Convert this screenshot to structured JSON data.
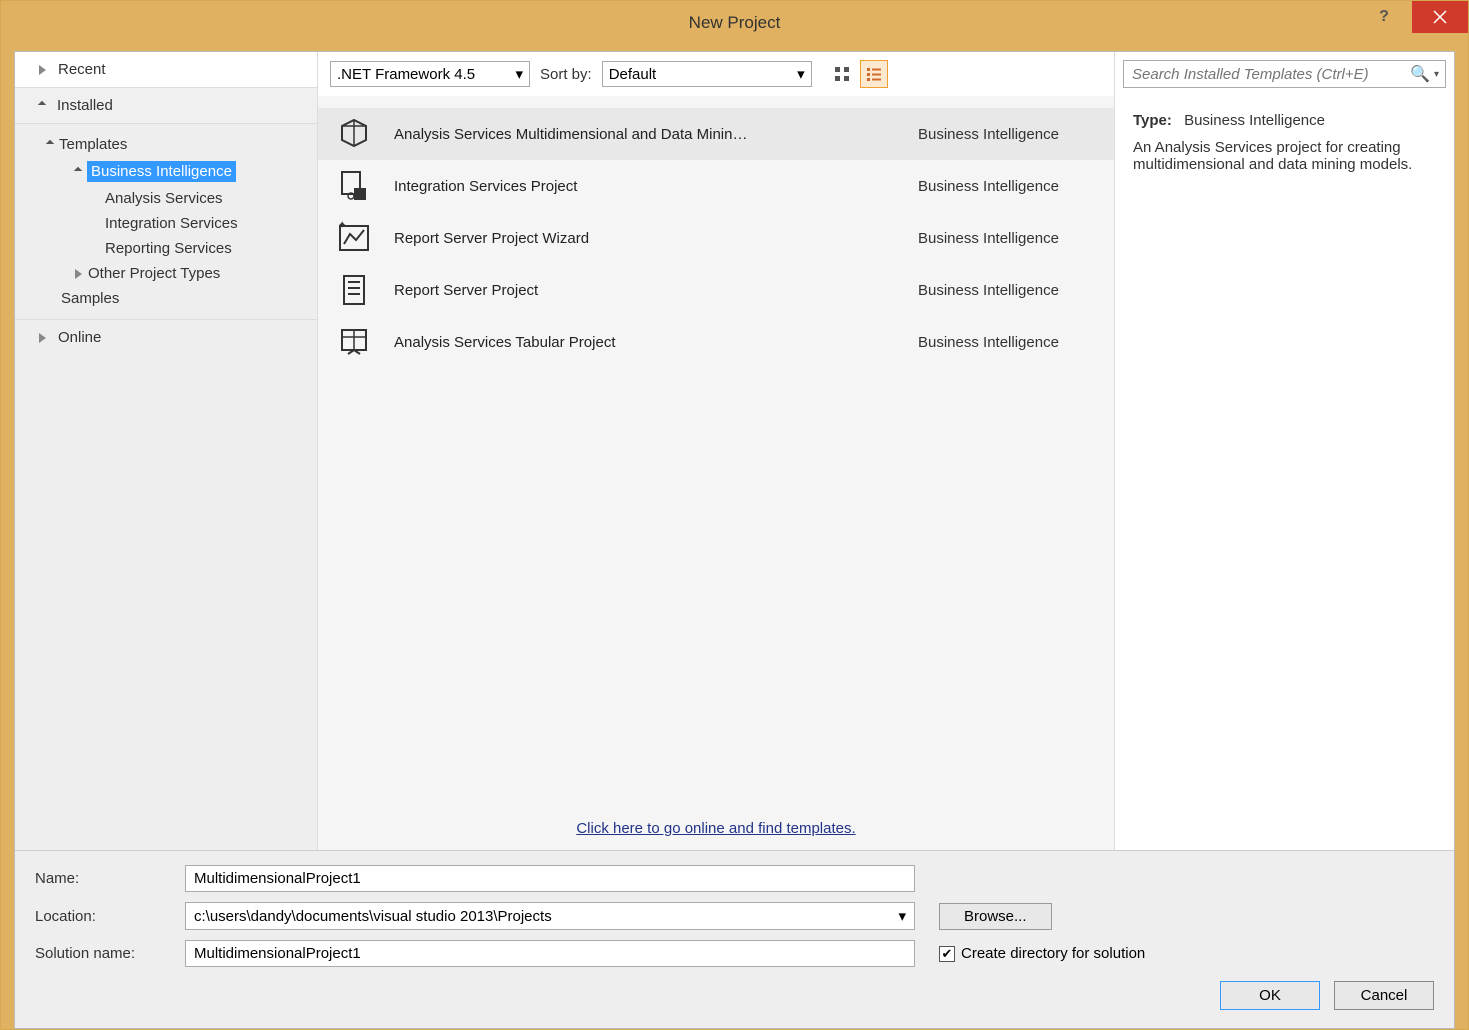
{
  "window": {
    "title": "New Project"
  },
  "sidebar": {
    "recent": "Recent",
    "installed": "Installed",
    "online": "Online",
    "tree": {
      "templates": "Templates",
      "business_intelligence": "Business Intelligence",
      "analysis_services": "Analysis Services",
      "integration_services": "Integration Services",
      "reporting_services": "Reporting Services",
      "other_project_types": "Other Project Types",
      "samples": "Samples"
    }
  },
  "toolbar": {
    "framework": ".NET Framework 4.5",
    "sortby_label": "Sort by:",
    "sortby_value": "Default"
  },
  "templates": [
    {
      "name": "Analysis Services Multidimensional and Data Minin…",
      "category": "Business Intelligence"
    },
    {
      "name": "Integration Services Project",
      "category": "Business Intelligence"
    },
    {
      "name": "Report Server Project Wizard",
      "category": "Business Intelligence"
    },
    {
      "name": "Report Server Project",
      "category": "Business Intelligence"
    },
    {
      "name": "Analysis Services Tabular Project",
      "category": "Business Intelligence"
    }
  ],
  "online_link": "Click here to go online and find templates.",
  "search": {
    "placeholder": "Search Installed Templates (Ctrl+E)"
  },
  "description": {
    "type_label": "Type:",
    "type_value": "Business Intelligence",
    "text": "An Analysis Services project for creating multidimensional and data mining models."
  },
  "form": {
    "name_label": "Name:",
    "name_value": "MultidimensionalProject1",
    "location_label": "Location:",
    "location_value": "c:\\users\\dandy\\documents\\visual studio 2013\\Projects",
    "solution_label": "Solution name:",
    "solution_value": "MultidimensionalProject1",
    "browse": "Browse...",
    "create_dir": "Create directory for solution",
    "ok": "OK",
    "cancel": "Cancel"
  }
}
